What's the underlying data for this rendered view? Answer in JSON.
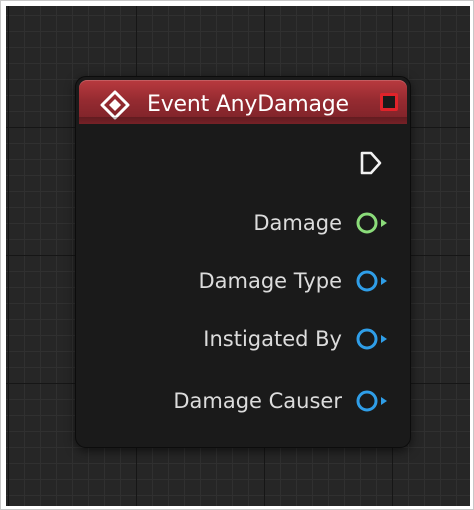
{
  "node": {
    "title": "Event AnyDamage",
    "header_color": "#962b31",
    "icons": {
      "event": "event-diamond-icon",
      "delegate": "delegate-square-icon",
      "exec": "exec-output-pin-icon"
    },
    "pins": [
      {
        "label": "Damage",
        "type": "float",
        "color": "#8bdc7a"
      },
      {
        "label": "Damage Type",
        "type": "object",
        "color": "#2f9ee8"
      },
      {
        "label": "Instigated By",
        "type": "object",
        "color": "#2f9ee8"
      },
      {
        "label": "Damage Causer",
        "type": "object",
        "color": "#2f9ee8"
      }
    ]
  }
}
